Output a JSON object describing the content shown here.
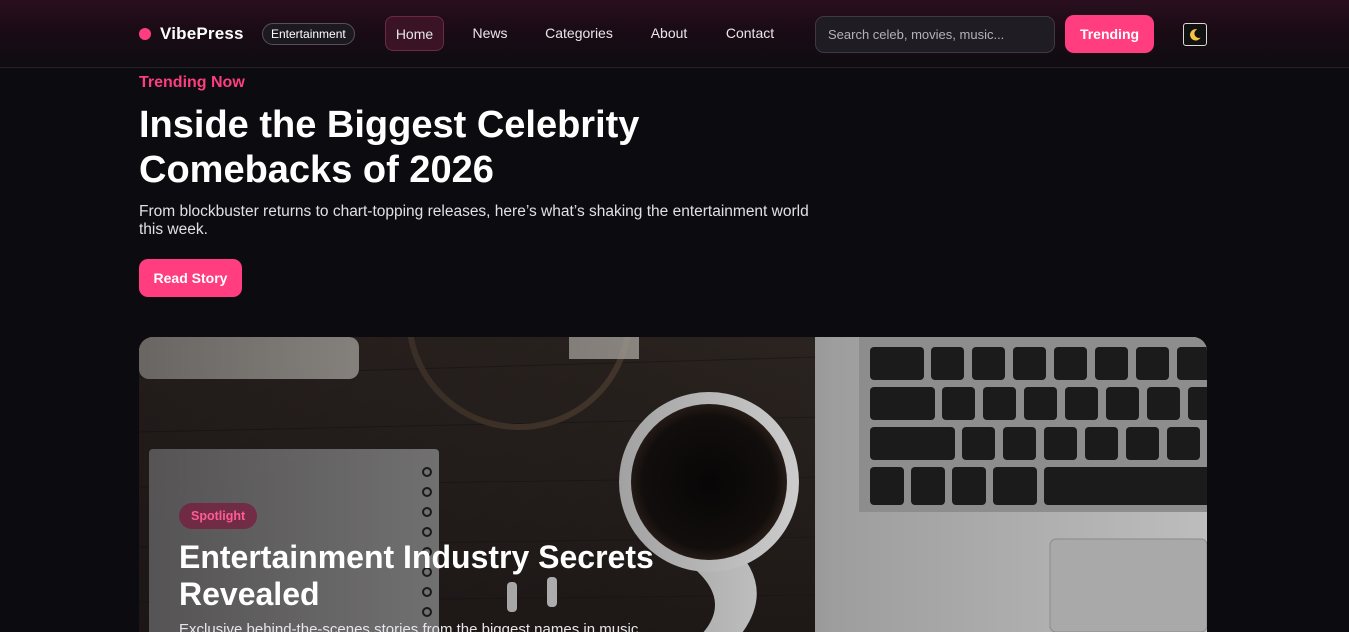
{
  "brand": {
    "name": "VibePress",
    "badge": "Entertainment",
    "accent_color": "#ff3d7f"
  },
  "nav": {
    "items": [
      {
        "label": "Home",
        "active": true
      },
      {
        "label": "News"
      },
      {
        "label": "Categories"
      },
      {
        "label": "About"
      },
      {
        "label": "Contact"
      }
    ]
  },
  "search": {
    "placeholder": "Search celeb, movies, music...",
    "value": ""
  },
  "header_actions": {
    "trending_label": "Trending",
    "theme_toggle_icon": "moon-icon"
  },
  "hero": {
    "kicker": "Trending Now",
    "title": "Inside the Biggest Celebrity Comebacks of 2026",
    "description": "From blockbuster returns to chart-topping releases, here’s what’s shaking the entertainment world this week.",
    "cta_label": "Read Story"
  },
  "feature": {
    "image_subject": "coffee-laptop-desk-photo",
    "badge": "Spotlight",
    "title": "Entertainment Industry Secrets Revealed",
    "description": "Exclusive behind-the-scenes stories from the biggest names in music"
  }
}
